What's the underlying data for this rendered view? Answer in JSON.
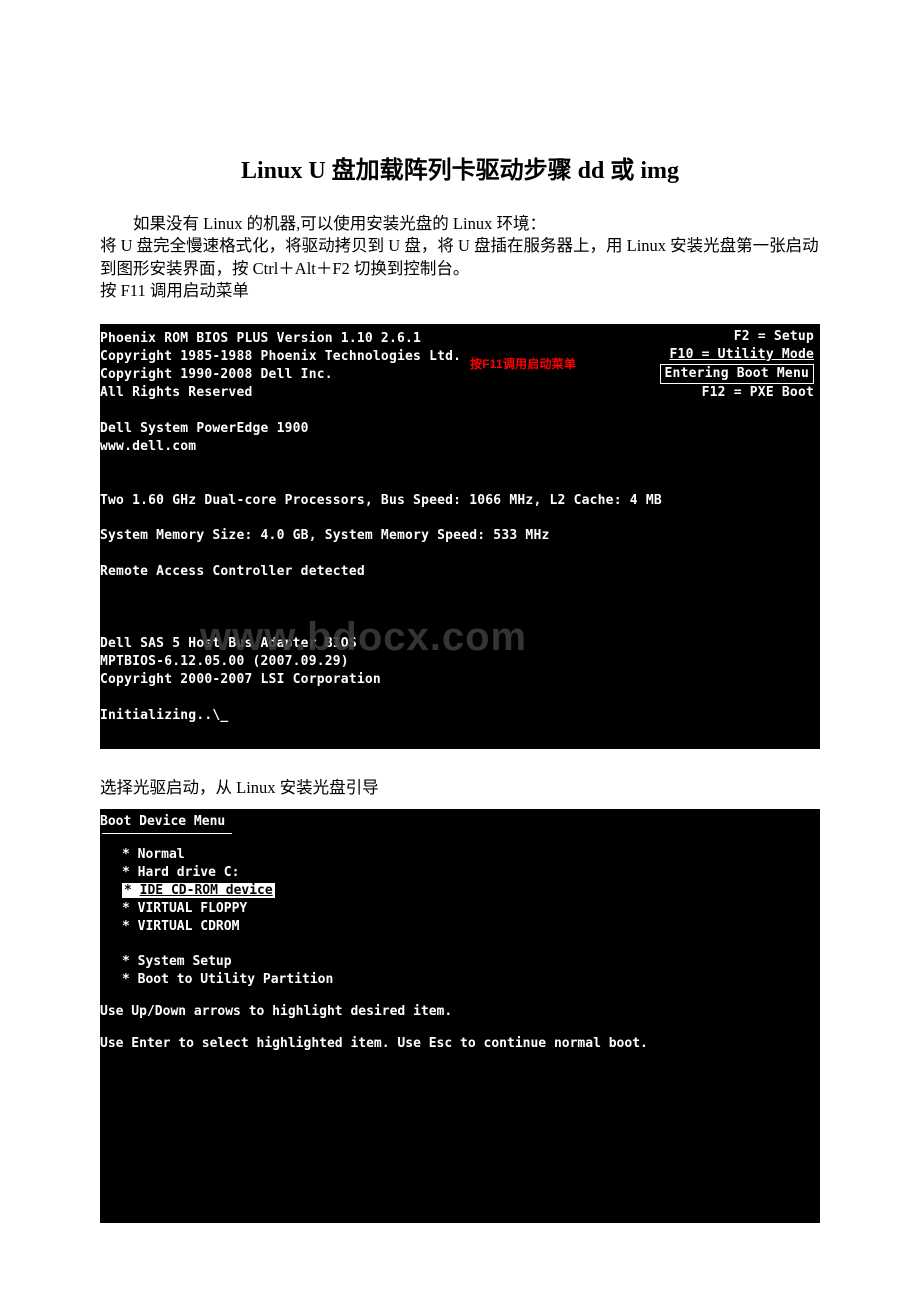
{
  "title": "Linux U 盘加载阵列卡驱动步骤 dd 或 img",
  "intro": {
    "line1": "如果没有 Linux 的机器,可以使用安装光盘的 Linux 环境：",
    "line2": "将 U 盘完全慢速格式化，将驱动拷贝到 U 盘，将 U 盘插在服务器上，用 Linux 安装光盘第一张启动到图形安装界面，按 Ctrl＋Alt＋F2 切换到控制台。",
    "line3": "按 F11 调用启动菜单"
  },
  "bios": {
    "top_right": {
      "f2": "F2 = Setup",
      "f10": "F10 = Utility Mode",
      "boot_menu_box": "Entering Boot Menu",
      "f12": "F12 = PXE Boot"
    },
    "lines": {
      "l1": "Phoenix ROM BIOS PLUS Version 1.10 2.6.1",
      "l2": "Copyright 1985-1988 Phoenix Technologies Ltd.",
      "l3": "Copyright 1990-2008 Dell Inc.",
      "l4": "All Rights Reserved",
      "l5": "Dell System PowerEdge 1900",
      "l6": "www.dell.com",
      "l7": "Two 1.60 GHz Dual-core Processors, Bus Speed: 1066 MHz, L2 Cache: 4 MB",
      "l8": "System Memory Size: 4.0 GB, System Memory Speed: 533 MHz",
      "l9": "Remote Access Controller detected",
      "l10": "Dell SAS 5 Host Bus Adapter BIOS",
      "l11": "MPTBIOS-6.12.05.00 (2007.09.29)",
      "l12": "Copyright 2000-2007 LSI Corporation",
      "l13": "Initializing..\\_"
    },
    "red_label": "按F11调用启动菜单",
    "watermark": "www.bdocx.com"
  },
  "mid_text": "选择光驱启动，从 Linux 安装光盘引导",
  "bootmenu": {
    "title": "Boot Device Menu",
    "items": {
      "normal": "Normal",
      "hd": "Hard drive C:",
      "cd": "IDE CD-ROM device",
      "vfloppy": "VIRTUAL  FLOPPY",
      "vcd": "VIRTUAL  CDROM",
      "setup": "System Setup",
      "util": "Boot to Utility Partition"
    },
    "instr1": "Use Up/Down arrows to highlight desired item.",
    "instr2": "Use Enter to select highlighted item. Use Esc to continue normal boot."
  }
}
